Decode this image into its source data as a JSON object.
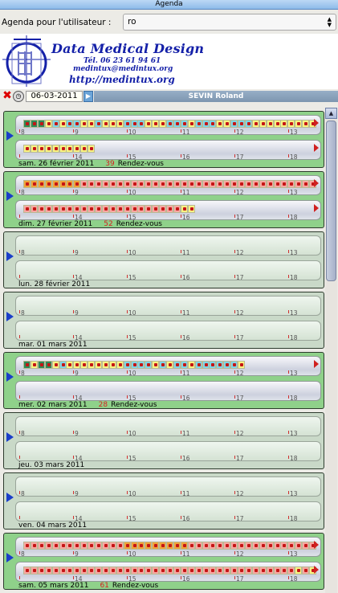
{
  "window": {
    "title": "Agenda"
  },
  "user_bar": {
    "label": "Agenda pour l'utilisateur :",
    "selected": "ro"
  },
  "logo": {
    "title": "Data Medical Design",
    "phone": "Tél. 06 23 61 94 61",
    "email": "medintux@medintux.org",
    "url": "http://medintux.org"
  },
  "nav": {
    "date": "06-03-2011",
    "user_name": "SEVIN Roland"
  },
  "hours_top": [
    "9",
    "10",
    "11",
    "12",
    "13"
  ],
  "hours_bottom": [
    "14",
    "15",
    "16",
    "17",
    "18",
    "19"
  ],
  "edge_labels": {
    "morning_start": "8",
    "afternoon_end": "19"
  },
  "colors": {
    "free": "#f7f483",
    "booked": "#7fd6e6",
    "present": "#f3a26c",
    "done": "#2f8a58",
    "pending": "#f7a8a2",
    "orange": "#f0a43a",
    "day_green": "#8fd18a",
    "day_grey": "#c9d9c8"
  },
  "days": [
    {
      "date": "sam. 26 février 2011",
      "count": "39",
      "count_label": "Rendez-vous",
      "has": true,
      "morning": [
        "done",
        "done",
        "done",
        "free",
        "booked",
        "free",
        "booked",
        "booked",
        "free",
        "free",
        "booked",
        "free",
        "free",
        "free",
        "booked",
        "booked",
        "booked",
        "free",
        "free",
        "free",
        "booked",
        "booked",
        "booked",
        "free",
        "booked",
        "booked",
        "booked",
        "free",
        "free",
        "booked",
        "booked",
        "booked",
        "free",
        "free",
        "free",
        "free",
        "free",
        "free",
        "free",
        "free",
        "free"
      ],
      "afternoon": [
        "free",
        "free",
        "free",
        "free",
        "free",
        "free",
        "free",
        "free",
        "free",
        "free"
      ]
    },
    {
      "date": "dim. 27 février 2011",
      "count": "52",
      "count_label": "Rendez-vous",
      "has": true,
      "morning": [
        "orange",
        "orange",
        "orange",
        "orange",
        "orange",
        "orange",
        "orange",
        "orange",
        "pending",
        "pending",
        "pending",
        "pending",
        "pending",
        "pending",
        "pending",
        "pending",
        "pending",
        "pending",
        "pending",
        "pending",
        "pending",
        "pending",
        "pending",
        "pending",
        "pending",
        "pending",
        "pending",
        "pending",
        "pending",
        "pending",
        "pending",
        "pending",
        "pending",
        "pending",
        "pending",
        "pending",
        "pending",
        "pending",
        "pending",
        "pending",
        "pending"
      ],
      "afternoon": [
        "pending",
        "pending",
        "pending",
        "pending",
        "pending",
        "pending",
        "pending",
        "pending",
        "pending",
        "pending",
        "pending",
        "pending",
        "pending",
        "pending",
        "pending",
        "pending",
        "pending",
        "pending",
        "pending",
        "pending",
        "pending",
        "pending",
        "free",
        "free"
      ]
    },
    {
      "date": "lun. 28 février 2011",
      "count": "",
      "count_label": "",
      "has": false,
      "morning": [],
      "afternoon": []
    },
    {
      "date": "mar. 01 mars 2011",
      "count": "",
      "count_label": "",
      "has": false,
      "morning": [],
      "afternoon": []
    },
    {
      "date": "mer. 02 mars 2011",
      "count": "28",
      "count_label": "Rendez-vous",
      "has": true,
      "morning": [
        "done",
        "free",
        "done",
        "done",
        "free",
        "booked",
        "free",
        "free",
        "free",
        "free",
        "free",
        "free",
        "free",
        "free",
        "booked",
        "booked",
        "booked",
        "booked",
        "free",
        "booked",
        "free",
        "booked",
        "booked",
        "free",
        "booked",
        "booked",
        "booked",
        "booked",
        "booked",
        "booked",
        "free"
      ],
      "afternoon": []
    },
    {
      "date": "jeu. 03 mars 2011",
      "count": "",
      "count_label": "",
      "has": false,
      "morning": [],
      "afternoon": []
    },
    {
      "date": "ven. 04 mars 2011",
      "count": "",
      "count_label": "",
      "has": false,
      "morning": [],
      "afternoon": []
    },
    {
      "date": "sam. 05 mars 2011",
      "count": "61",
      "count_label": "Rendez-vous",
      "has": true,
      "morning": [
        "pending",
        "pending",
        "pending",
        "pending",
        "pending",
        "pending",
        "pending",
        "pending",
        "pending",
        "pending",
        "pending",
        "pending",
        "pending",
        "pending",
        "orange",
        "orange",
        "orange",
        "orange",
        "orange",
        "orange",
        "orange",
        "orange",
        "orange",
        "pending",
        "pending",
        "pending",
        "pending",
        "pending",
        "pending",
        "pending",
        "pending",
        "pending",
        "pending",
        "pending",
        "pending",
        "pending",
        "pending",
        "pending",
        "pending",
        "pending",
        "pending"
      ],
      "afternoon": [
        "pending",
        "pending",
        "pending",
        "pending",
        "pending",
        "pending",
        "pending",
        "pending",
        "pending",
        "pending",
        "pending",
        "pending",
        "pending",
        "pending",
        "pending",
        "pending",
        "pending",
        "pending",
        "pending",
        "pending",
        "pending",
        "pending",
        "pending",
        "pending",
        "pending",
        "pending",
        "pending",
        "pending",
        "pending",
        "pending",
        "pending",
        "pending",
        "pending",
        "pending",
        "pending",
        "pending",
        "pending",
        "pending",
        "free",
        "pending",
        "free"
      ]
    }
  ]
}
